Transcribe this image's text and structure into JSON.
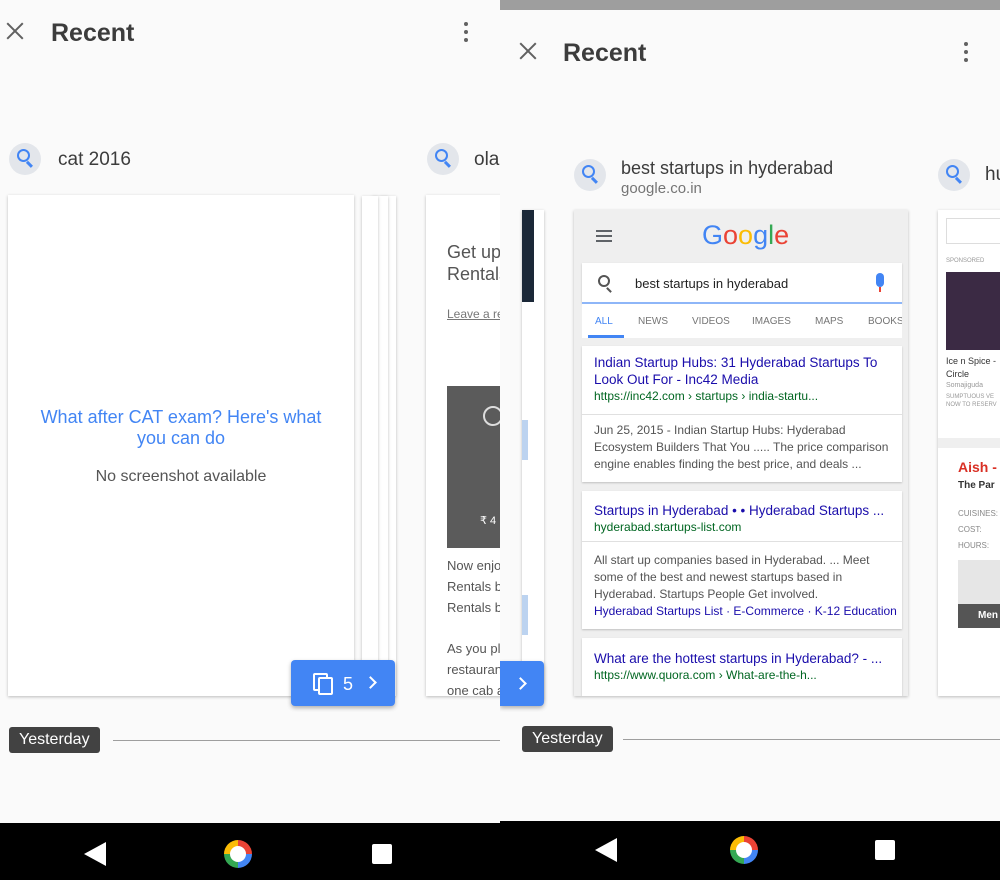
{
  "left": {
    "title": "Recent",
    "query1": "cat 2016",
    "query2": "ola",
    "card1": {
      "heading": "What after CAT exam? Here's what you can do",
      "note": "No screenshot available"
    },
    "card2": {
      "line1": "Get up",
      "line2": "Rentals",
      "link": "Leave a re",
      "price": "₹ 4",
      "t1": "Now enjo",
      "t2": "Rentals b",
      "t3": "Rentals b",
      "t4": "As you pl",
      "t5": "restauran",
      "t6": "one cab a"
    },
    "tabs_count": "5",
    "yesterday": "Yesterday"
  },
  "right": {
    "title": "Recent",
    "query": "best startups in hyderabad",
    "domain": "google.co.in",
    "query2": "hu",
    "google_logo": "Google",
    "search_value": "best startups in hyderabad",
    "tabs": [
      "ALL",
      "NEWS",
      "VIDEOS",
      "IMAGES",
      "MAPS",
      "BOOKS"
    ],
    "results": [
      {
        "title": "Indian Startup Hubs: 31 Hyderabad Startups To Look Out For - Inc42 Media",
        "url": "https://inc42.com › startups › india-startu...",
        "snippet": "Jun 25, 2015 - Indian Startup Hubs: Hyderabad Ecosystem Builders That You ..... The price comparison engine enables finding the best price, and deals ..."
      },
      {
        "title": "Startups in Hyderabad • • Hyderabad Startups ...",
        "url": "hyderabad.startups-list.com",
        "snippet": "All start up companies based in Hyderabad. ... Meet some of the best and newest startups based in Hyderabad. Startups People Get involved.",
        "sublinks": [
          "Hyderabad Startups List",
          "E-Commerce",
          "K-12 Education"
        ]
      },
      {
        "title": "What are the hottest startups in Hyderabad? - ...",
        "url": "https://www.quora.com › What-are-the-h..."
      }
    ],
    "side_card": {
      "sponsored": "SPONSORED",
      "name1": "Ice n Spice -",
      "name2": "Circle",
      "loc": "Somajiguda",
      "promo1": "SUMPTUOUS VE",
      "promo2": "NOW TO RESERV",
      "brand": "Aish -",
      "sub": "The Par",
      "cuisines": "CUISINES:",
      "cost": "COST:",
      "hours": "HOURS:",
      "menu": "Men"
    },
    "yesterday": "Yesterday"
  },
  "colors": {
    "accent": "#4285f4",
    "link": "#1a0dab",
    "url": "#006621"
  }
}
